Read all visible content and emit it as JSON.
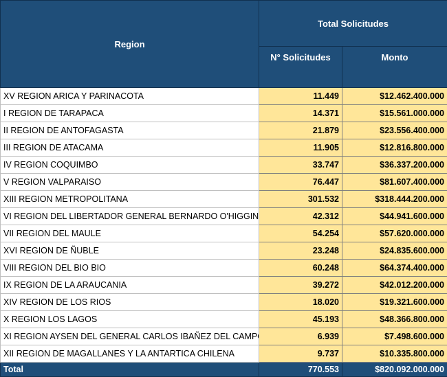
{
  "header": {
    "region": "Region",
    "total_solicitudes": "Total Solicitudes",
    "n_solicitudes": "N° Solicitudes",
    "monto": "Monto"
  },
  "rows": [
    {
      "region": "XV REGION ARICA Y PARINACOTA",
      "solicitudes": "11.449",
      "monto": "$12.462.400.000"
    },
    {
      "region": "I REGION DE TARAPACA",
      "solicitudes": "14.371",
      "monto": "$15.561.000.000"
    },
    {
      "region": "II REGION DE ANTOFAGASTA",
      "solicitudes": "21.879",
      "monto": "$23.556.400.000"
    },
    {
      "region": "III REGION DE ATACAMA",
      "solicitudes": "11.905",
      "monto": "$12.816.800.000"
    },
    {
      "region": "IV REGION COQUIMBO",
      "solicitudes": "33.747",
      "monto": "$36.337.200.000"
    },
    {
      "region": "V REGION VALPARAISO",
      "solicitudes": "76.447",
      "monto": "$81.607.400.000"
    },
    {
      "region": "XIII REGION METROPOLITANA",
      "solicitudes": "301.532",
      "monto": "$318.444.200.000"
    },
    {
      "region": "VI REGION DEL LIBERTADOR GENERAL BERNARDO O'HIGGIN",
      "solicitudes": "42.312",
      "monto": "$44.941.600.000"
    },
    {
      "region": "VII REGION DEL MAULE",
      "solicitudes": "54.254",
      "monto": "$57.620.000.000"
    },
    {
      "region": "XVI REGION DE ÑUBLE",
      "solicitudes": "23.248",
      "monto": "$24.835.600.000"
    },
    {
      "region": "VIII REGION DEL BIO BIO",
      "solicitudes": "60.248",
      "monto": "$64.374.400.000"
    },
    {
      "region": "IX REGION DE LA ARAUCANIA",
      "solicitudes": "39.272",
      "monto": "$42.012.200.000"
    },
    {
      "region": "XIV REGION DE LOS RIOS",
      "solicitudes": "18.020",
      "monto": "$19.321.600.000"
    },
    {
      "region": "X REGION LOS LAGOS",
      "solicitudes": "45.193",
      "monto": "$48.366.800.000"
    },
    {
      "region": "XI REGION AYSEN DEL GENERAL CARLOS IBAÑEZ DEL CAMPO",
      "solicitudes": "6.939",
      "monto": "$7.498.600.000"
    },
    {
      "region": "XII REGION DE MAGALLANES Y LA ANTARTICA CHILENA",
      "solicitudes": "9.737",
      "monto": "$10.335.800.000"
    }
  ],
  "total": {
    "label": "Total",
    "solicitudes": "770.553",
    "monto": "$820.092.000.000"
  }
}
